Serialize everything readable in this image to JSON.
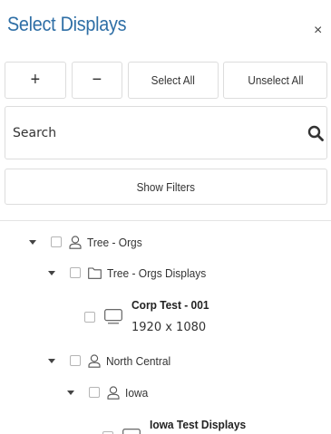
{
  "header": {
    "title": "Select Displays",
    "close_label": "×"
  },
  "toolbar": {
    "expand_label": "+",
    "collapse_label": "−",
    "select_all_label": "Select All",
    "unselect_all_label": "Unselect All"
  },
  "search": {
    "placeholder": "Search",
    "value": ""
  },
  "filters": {
    "show_filters_label": "Show Filters"
  },
  "tree": {
    "tree_orgs": {
      "label": "Tree - Orgs",
      "icon": "user-icon",
      "expanded": true,
      "checked": false
    },
    "tree_orgs_displays": {
      "label": "Tree - Orgs Displays",
      "icon": "folder-icon",
      "expanded": true,
      "checked": false
    },
    "corp_test": {
      "name": "Corp Test - 001",
      "resolution": "1920 x 1080",
      "icon": "monitor-icon",
      "checked": false
    },
    "north_central": {
      "label": "North Central",
      "icon": "user-icon",
      "expanded": true,
      "checked": false
    },
    "iowa": {
      "label": "Iowa",
      "icon": "user-icon",
      "expanded": true,
      "checked": false
    },
    "iowa_test": {
      "name": "Iowa Test Displays",
      "icon": "monitor-icon",
      "checked": false
    }
  }
}
